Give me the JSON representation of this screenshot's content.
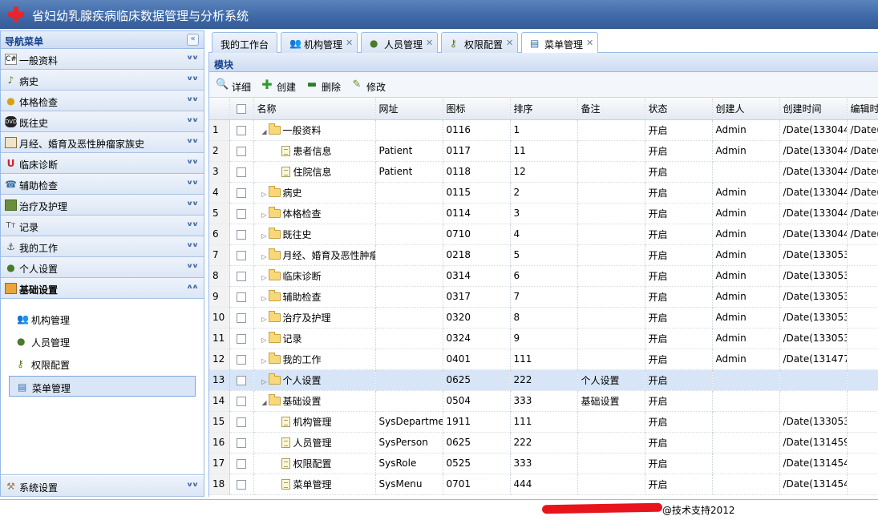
{
  "app": {
    "title": "省妇幼乳腺疾病临床数据管理与分析系统",
    "logo_icon": "red-cross-icon"
  },
  "sidebar": {
    "title": "导航菜单",
    "sections": [
      {
        "label": "一般资料",
        "icon": "csharp-icon"
      },
      {
        "label": "病史",
        "icon": "music-note-icon"
      },
      {
        "label": "体格检查",
        "icon": "lock-icon"
      },
      {
        "label": "既往史",
        "icon": "dvd-icon"
      },
      {
        "label": "月经、婚育及恶性肿瘤家族史",
        "icon": "book-icon"
      },
      {
        "label": "临床诊断",
        "icon": "magnet-icon"
      },
      {
        "label": "辅助检查",
        "icon": "phone-icon"
      },
      {
        "label": "治疗及护理",
        "icon": "board-icon"
      },
      {
        "label": "记录",
        "icon": "text-icon"
      },
      {
        "label": "我的工作",
        "icon": "anchor-icon"
      },
      {
        "label": "个人设置",
        "icon": "user-icon"
      },
      {
        "label": "基础设置",
        "icon": "settings-icon"
      }
    ],
    "sub_items": [
      {
        "label": "机构管理",
        "icon": "group-icon"
      },
      {
        "label": "人员管理",
        "icon": "user-icon"
      },
      {
        "label": "权限配置",
        "icon": "key-icon"
      },
      {
        "label": "菜单管理",
        "icon": "menu-icon"
      }
    ],
    "bottom_section": {
      "label": "系统设置",
      "icon": "wrench-icon"
    }
  },
  "tabs": [
    {
      "label": "我的工作台",
      "closable": false
    },
    {
      "label": "机构管理",
      "closable": true
    },
    {
      "label": "人员管理",
      "closable": true
    },
    {
      "label": "权限配置",
      "closable": true
    },
    {
      "label": "菜单管理",
      "closable": true
    }
  ],
  "panel": {
    "title": "模块"
  },
  "toolbar": {
    "detail": "详细",
    "create": "创建",
    "delete": "删除",
    "edit": "修改"
  },
  "grid": {
    "columns": [
      "名称",
      "网址",
      "图标",
      "排序",
      "备注",
      "状态",
      "创建人",
      "创建时间",
      "编辑时"
    ],
    "rows": [
      {
        "n": "1",
        "name": "一般资料",
        "url": "",
        "icon": "0116",
        "sort": "1",
        "note": "",
        "status": "开启",
        "creator": "Admin",
        "ctime": "/Date(133044",
        "etime": "/Date("
      },
      {
        "n": "2",
        "name": "患者信息",
        "url": "Patient",
        "icon": "0117",
        "sort": "11",
        "note": "",
        "status": "开启",
        "creator": "Admin",
        "ctime": "/Date(133044",
        "etime": "/Date("
      },
      {
        "n": "3",
        "name": "住院信息",
        "url": "Patient",
        "icon": "0118",
        "sort": "12",
        "note": "",
        "status": "开启",
        "creator": "",
        "ctime": "/Date(133044",
        "etime": "/Date("
      },
      {
        "n": "4",
        "name": "病史",
        "url": "",
        "icon": "0115",
        "sort": "2",
        "note": "",
        "status": "开启",
        "creator": "Admin",
        "ctime": "/Date(133044",
        "etime": "/Date("
      },
      {
        "n": "5",
        "name": "体格检查",
        "url": "",
        "icon": "0114",
        "sort": "3",
        "note": "",
        "status": "开启",
        "creator": "Admin",
        "ctime": "/Date(133044",
        "etime": "/Date("
      },
      {
        "n": "6",
        "name": "既往史",
        "url": "",
        "icon": "0710",
        "sort": "4",
        "note": "",
        "status": "开启",
        "creator": "Admin",
        "ctime": "/Date(133044",
        "etime": "/Date("
      },
      {
        "n": "7",
        "name": "月经、婚育及恶性肿瘤",
        "url": "",
        "icon": "0218",
        "sort": "5",
        "note": "",
        "status": "开启",
        "creator": "Admin",
        "ctime": "/Date(133053",
        "etime": ""
      },
      {
        "n": "8",
        "name": "临床诊断",
        "url": "",
        "icon": "0314",
        "sort": "6",
        "note": "",
        "status": "开启",
        "creator": "Admin",
        "ctime": "/Date(133053",
        "etime": ""
      },
      {
        "n": "9",
        "name": "辅助检查",
        "url": "",
        "icon": "0317",
        "sort": "7",
        "note": "",
        "status": "开启",
        "creator": "Admin",
        "ctime": "/Date(133053",
        "etime": ""
      },
      {
        "n": "10",
        "name": "治疗及护理",
        "url": "",
        "icon": "0320",
        "sort": "8",
        "note": "",
        "status": "开启",
        "creator": "Admin",
        "ctime": "/Date(133053",
        "etime": ""
      },
      {
        "n": "11",
        "name": "记录",
        "url": "",
        "icon": "0324",
        "sort": "9",
        "note": "",
        "status": "开启",
        "creator": "Admin",
        "ctime": "/Date(133053",
        "etime": ""
      },
      {
        "n": "12",
        "name": "我的工作",
        "url": "",
        "icon": "0401",
        "sort": "111",
        "note": "",
        "status": "开启",
        "creator": "Admin",
        "ctime": "/Date(131477",
        "etime": ""
      },
      {
        "n": "13",
        "name": "个人设置",
        "url": "",
        "icon": "0625",
        "sort": "222",
        "note": "个人设置",
        "status": "开启",
        "creator": "",
        "ctime": "",
        "etime": ""
      },
      {
        "n": "14",
        "name": "基础设置",
        "url": "",
        "icon": "0504",
        "sort": "333",
        "note": "基础设置",
        "status": "开启",
        "creator": "",
        "ctime": "",
        "etime": ""
      },
      {
        "n": "15",
        "name": "机构管理",
        "url": "SysDepartme",
        "icon": "1911",
        "sort": "111",
        "note": "",
        "status": "开启",
        "creator": "",
        "ctime": "/Date(133053",
        "etime": ""
      },
      {
        "n": "16",
        "name": "人员管理",
        "url": "SysPerson",
        "icon": "0625",
        "sort": "222",
        "note": "",
        "status": "开启",
        "creator": "",
        "ctime": "/Date(131459",
        "etime": ""
      },
      {
        "n": "17",
        "name": "权限配置",
        "url": "SysRole",
        "icon": "0525",
        "sort": "333",
        "note": "",
        "status": "开启",
        "creator": "",
        "ctime": "/Date(131454",
        "etime": ""
      },
      {
        "n": "18",
        "name": "菜单管理",
        "url": "SysMenu",
        "icon": "0701",
        "sort": "444",
        "note": "",
        "status": "开启",
        "creator": "",
        "ctime": "/Date(131454",
        "etime": ""
      }
    ]
  },
  "footer": {
    "text": "@技术支持2012"
  },
  "colors": {
    "title_bar": "#3e68a6",
    "sidebar_header_text": "#15428b",
    "selected_row": "#d7e5f7",
    "redaction": "#e8141c"
  }
}
